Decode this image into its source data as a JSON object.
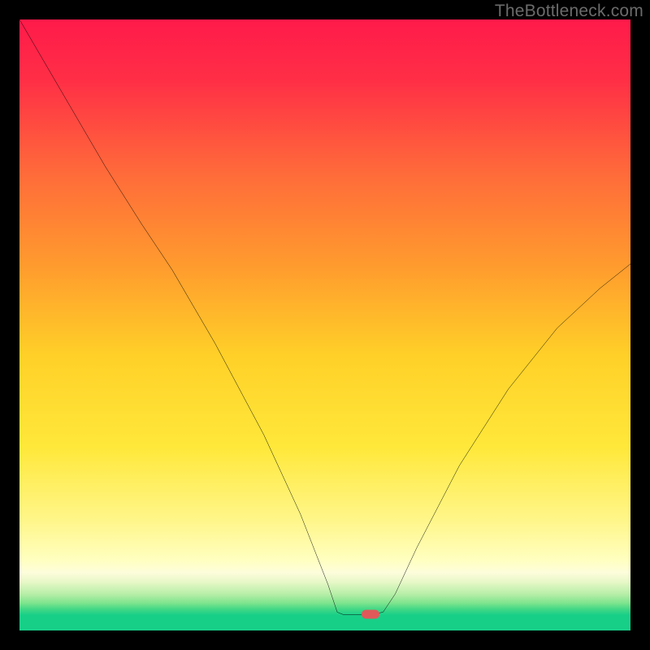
{
  "watermark": "TheBottleneck.com",
  "marker_color": "#e05a5a",
  "chart_data": {
    "type": "line",
    "title": "",
    "xlabel": "",
    "ylabel": "",
    "xlim": [
      0,
      100
    ],
    "ylim": [
      0,
      100
    ],
    "gradient_stops": [
      {
        "pos": 0.0,
        "color": "#ff1a4a"
      },
      {
        "pos": 0.1,
        "color": "#ff2f46"
      },
      {
        "pos": 0.25,
        "color": "#ff6a3a"
      },
      {
        "pos": 0.4,
        "color": "#ff9a2e"
      },
      {
        "pos": 0.55,
        "color": "#ffd028"
      },
      {
        "pos": 0.7,
        "color": "#ffe83a"
      },
      {
        "pos": 0.82,
        "color": "#fff68a"
      },
      {
        "pos": 0.885,
        "color": "#ffffc0"
      },
      {
        "pos": 0.905,
        "color": "#fdfddc"
      },
      {
        "pos": 0.92,
        "color": "#e8f8c8"
      },
      {
        "pos": 0.94,
        "color": "#b8efa8"
      },
      {
        "pos": 0.955,
        "color": "#7fe48e"
      },
      {
        "pos": 0.965,
        "color": "#43d886"
      },
      {
        "pos": 0.975,
        "color": "#18cf88"
      },
      {
        "pos": 1.0,
        "color": "#18cf88"
      }
    ],
    "curve_points": [
      {
        "x": 0.0,
        "y": 100.0
      },
      {
        "x": 7.0,
        "y": 88.0
      },
      {
        "x": 14.0,
        "y": 76.0
      },
      {
        "x": 20.0,
        "y": 66.5
      },
      {
        "x": 25.0,
        "y": 59.0
      },
      {
        "x": 32.0,
        "y": 47.0
      },
      {
        "x": 40.0,
        "y": 32.0
      },
      {
        "x": 46.0,
        "y": 19.0
      },
      {
        "x": 50.5,
        "y": 7.5
      },
      {
        "x": 52.0,
        "y": 3.0
      },
      {
        "x": 53.0,
        "y": 2.6
      },
      {
        "x": 55.0,
        "y": 2.6
      },
      {
        "x": 57.5,
        "y": 2.6
      },
      {
        "x": 59.5,
        "y": 3.0
      },
      {
        "x": 61.5,
        "y": 6.0
      },
      {
        "x": 65.0,
        "y": 13.5
      },
      {
        "x": 72.0,
        "y": 27.0
      },
      {
        "x": 80.0,
        "y": 39.5
      },
      {
        "x": 88.0,
        "y": 49.5
      },
      {
        "x": 95.0,
        "y": 56.0
      },
      {
        "x": 100.0,
        "y": 60.0
      }
    ],
    "marker": {
      "x": 57.5,
      "y": 2.6
    }
  }
}
